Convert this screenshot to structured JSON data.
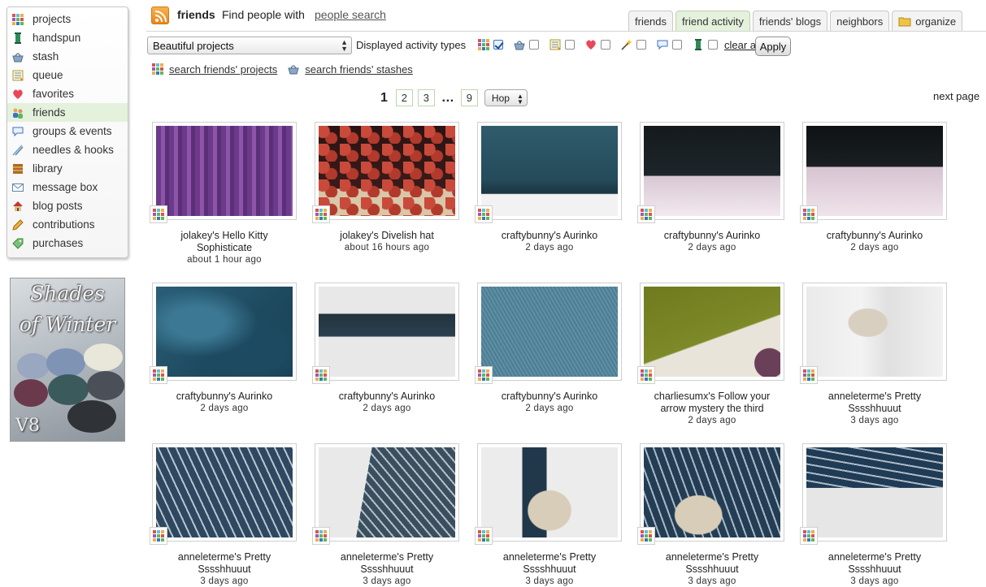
{
  "sidebar": {
    "items": [
      {
        "label": "projects",
        "icon": "projects-icon",
        "active": false
      },
      {
        "label": "handspun",
        "icon": "spindle-icon",
        "active": false
      },
      {
        "label": "stash",
        "icon": "basket-icon",
        "active": false
      },
      {
        "label": "queue",
        "icon": "queue-icon",
        "active": false
      },
      {
        "label": "favorites",
        "icon": "heart-icon",
        "active": false
      },
      {
        "label": "friends",
        "icon": "people-icon",
        "active": true
      },
      {
        "label": "groups & events",
        "icon": "speech-bubble-icon",
        "active": false
      },
      {
        "label": "needles & hooks",
        "icon": "needles-icon",
        "active": false
      },
      {
        "label": "library",
        "icon": "books-icon",
        "active": false
      },
      {
        "label": "message box",
        "icon": "envelope-icon",
        "active": false
      },
      {
        "label": "blog posts",
        "icon": "house-icon",
        "active": false
      },
      {
        "label": "contributions",
        "icon": "pencil-icon",
        "active": false
      },
      {
        "label": "purchases",
        "icon": "tag-icon",
        "active": false
      }
    ]
  },
  "banner": {
    "line1": "Shades",
    "line2": "of Winter",
    "mark": "V8"
  },
  "header": {
    "title": "friends",
    "find_text": "Find people with",
    "find_link": "people search"
  },
  "tabs": [
    {
      "label": "friends",
      "active": false
    },
    {
      "label": "friend activity",
      "active": true
    },
    {
      "label": "friends' blogs",
      "active": false
    },
    {
      "label": "neighbors",
      "active": false
    },
    {
      "label": "organize",
      "active": false,
      "icon": "folder-icon"
    }
  ],
  "filter": {
    "select_value": "Beautiful projects",
    "types_label": "Displayed activity types",
    "types": [
      {
        "icon": "projects-icon",
        "checked": true
      },
      {
        "icon": "basket-icon",
        "checked": false
      },
      {
        "icon": "queue-icon",
        "checked": false
      },
      {
        "icon": "heart-icon",
        "checked": false
      },
      {
        "icon": "wand-icon",
        "checked": false
      },
      {
        "icon": "speech-bubble-icon",
        "checked": false
      },
      {
        "icon": "spindle-icon",
        "checked": false
      }
    ],
    "clear_all": "clear all",
    "apply": "Apply"
  },
  "search_links": [
    {
      "label": "search friends' projects",
      "icon": "projects-icon"
    },
    {
      "label": "search friends' stashes",
      "icon": "basket-icon"
    }
  ],
  "pager": {
    "current": "1",
    "pages": [
      "2",
      "3"
    ],
    "ellipsis": "…",
    "last": "9",
    "hop": "Hop",
    "next": "next page"
  },
  "items": [
    {
      "caption": "jolakey's Hello Kitty Sophisticate",
      "time": "about 1 hour ago",
      "photo": "p-purple"
    },
    {
      "caption": "jolakey's Divelish hat",
      "time": "about 16 hours ago",
      "photo": "p-redhat"
    },
    {
      "caption": "craftybunny's Aurinko",
      "time": "2 days ago",
      "photo": "p-teal"
    },
    {
      "caption": "craftybunny's Aurinko",
      "time": "2 days ago",
      "photo": "p-dark"
    },
    {
      "caption": "craftybunny's Aurinko",
      "time": "2 days ago",
      "photo": "p-dark2"
    },
    {
      "caption": "craftybunny's Aurinko",
      "time": "2 days ago",
      "photo": "p-fold"
    },
    {
      "caption": "craftybunny's Aurinko",
      "time": "2 days ago",
      "photo": "p-points"
    },
    {
      "caption": "craftybunny's Aurinko",
      "time": "2 days ago",
      "photo": "p-knit"
    },
    {
      "caption": "charliesumx's Follow your arrow mystery the third",
      "time": "2 days ago",
      "photo": "p-green"
    },
    {
      "caption": "anneleterme's Pretty Sssshhuuut",
      "time": "3 days ago",
      "photo": "p-mannequin"
    },
    {
      "caption": "anneleterme's Pretty Sssshhuuut",
      "time": "3 days ago",
      "photo": "p-stripe"
    },
    {
      "caption": "anneleterme's Pretty Sssshhuuut",
      "time": "3 days ago",
      "photo": "p-stripe2"
    },
    {
      "caption": "anneleterme's Pretty Sssshhuuut",
      "time": "3 days ago",
      "photo": "p-stripe3"
    },
    {
      "caption": "anneleterme's Pretty Sssshhuuut",
      "time": "3 days ago",
      "photo": "p-stripe4"
    },
    {
      "caption": "anneleterme's Pretty Sssshhuuut",
      "time": "3 days ago",
      "photo": "p-stripe5"
    }
  ]
}
